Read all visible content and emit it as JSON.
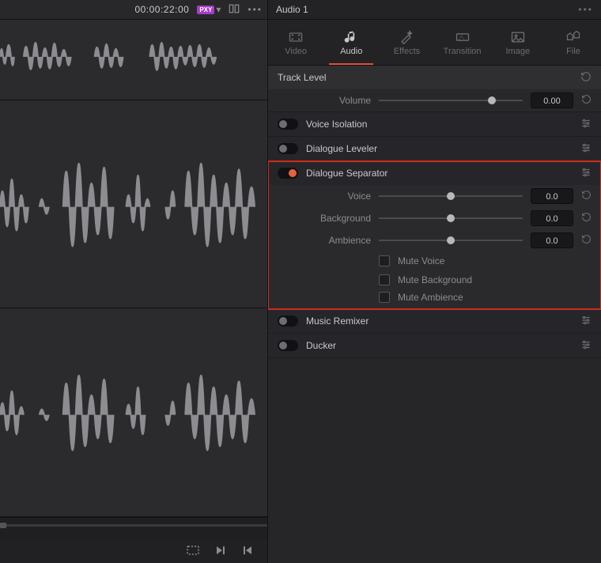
{
  "timeline": {
    "timecode": "00:00:22:00",
    "proxy_badge": "PXY"
  },
  "inspector": {
    "title": "Audio 1",
    "tabs": {
      "video": "Video",
      "audio": "Audio",
      "effects": "Effects",
      "transition": "Transition",
      "image": "Image",
      "file": "File"
    },
    "track_level": {
      "label": "Track Level",
      "volume_label": "Volume",
      "volume_value": "0.00"
    },
    "voice_isolation": {
      "label": "Voice Isolation"
    },
    "dialogue_leveler": {
      "label": "Dialogue Leveler"
    },
    "dialogue_separator": {
      "label": "Dialogue Separator",
      "voice_label": "Voice",
      "voice_value": "0.0",
      "background_label": "Background",
      "background_value": "0.0",
      "ambience_label": "Ambience",
      "ambience_value": "0.0",
      "mute_voice": "Mute Voice",
      "mute_background": "Mute Background",
      "mute_ambience": "Mute Ambience"
    },
    "music_remixer": {
      "label": "Music Remixer"
    },
    "ducker": {
      "label": "Ducker"
    }
  }
}
